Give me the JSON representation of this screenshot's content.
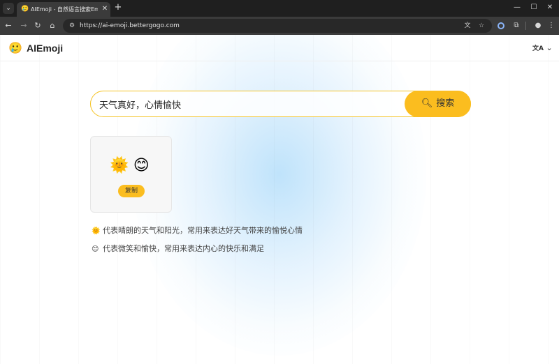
{
  "browser": {
    "tab_title": "AIEmoji - 自然语言搜索Emoji",
    "tab_favicon": "🥲",
    "new_tab_label": "+",
    "url": "https://ai-emoji.bettergogo.com",
    "window_controls": {
      "minimize": "—",
      "maximize": "☐",
      "close": "✕"
    },
    "nav": {
      "back": "←",
      "forward": "→",
      "reload": "↻",
      "home": "⌂"
    }
  },
  "header": {
    "logo_emoji": "🥲",
    "logo_text": "AIEmoji",
    "language_icon": "文A",
    "language_chevron": "⌄"
  },
  "search": {
    "value": "天气真好，心情愉快",
    "button_label": "搜索"
  },
  "result": {
    "emojis": "🌞😊",
    "copy_label": "复制"
  },
  "descriptions": [
    {
      "emoji": "🌞",
      "text": "代表晴朗的天气和阳光，常用来表达好天气带来的愉悦心情"
    },
    {
      "emoji": "😊",
      "text": "代表微笑和愉快，常用来表达内心的快乐和满足"
    }
  ],
  "colors": {
    "accent": "#fbbd1f",
    "search_border": "#f5c323",
    "chrome_dark": "#1f1f1f",
    "chrome_toolbar": "#3b3b3b"
  }
}
